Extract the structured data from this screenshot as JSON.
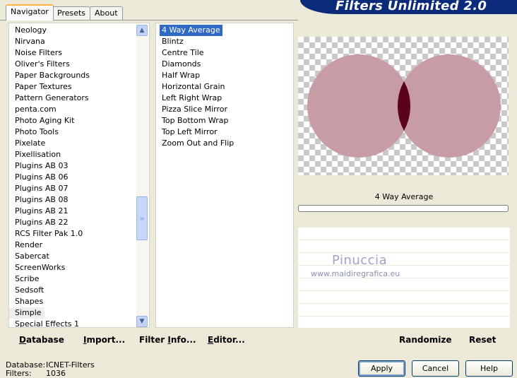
{
  "banner": {
    "title": "Filters Unlimited 2.0"
  },
  "tabs": [
    {
      "label": "Navigator"
    },
    {
      "label": "Presets"
    },
    {
      "label": "About"
    }
  ],
  "categories": {
    "items": [
      "Neology",
      "Nirvana",
      "Noise Filters",
      "Oliver's Filters",
      "Paper Backgrounds",
      "Paper Textures",
      "Pattern Generators",
      "penta.com",
      "Photo Aging Kit",
      "Photo Tools",
      "Pixelate",
      "Pixellisation",
      "Plugins AB 03",
      "Plugins AB 06",
      "Plugins AB 07",
      "Plugins AB 08",
      "Plugins AB 21",
      "Plugins AB 22",
      "RCS Filter Pak 1.0",
      "Render",
      "Sabercat",
      "ScreenWorks",
      "Scribe",
      "Sedsoft",
      "Shapes",
      "Simple",
      "Special Effects 1"
    ],
    "selected": "Simple",
    "scroll_position": 0.68
  },
  "filters": {
    "items": [
      "4 Way Average",
      "Blintz",
      "Centre Tile",
      "Diamonds",
      "Half Wrap",
      "Horizontal Grain",
      "Left Right Wrap",
      "Pizza Slice Mirror",
      "Top Bottom Wrap",
      "Top Left Mirror",
      "Zoom Out and Flip"
    ],
    "selected": "4 Way Average"
  },
  "preview": {
    "filter_name": "4 Way Average",
    "circle_color": "#c79ca5",
    "overlap_color": "#5a0319"
  },
  "watermark": {
    "name": "Pinuccia",
    "url": "www.maidiregrafica.eu"
  },
  "panel_buttons": {
    "database": {
      "u": "D",
      "rest": "atabase"
    },
    "import": {
      "u": "I",
      "rest": "mport..."
    },
    "filter_info": {
      "pre": "Filter ",
      "u": "I",
      "rest": "nfo..."
    },
    "editor": {
      "u": "E",
      "rest": "ditor..."
    },
    "randomize": "Randomize",
    "reset": "Reset"
  },
  "status": {
    "database_label": "Database:",
    "database_value": "ICNET-Filters",
    "filters_label": "Filters:",
    "filters_value": "1036"
  },
  "dialog_buttons": {
    "apply": "Apply",
    "cancel": "Cancel",
    "help": "Help"
  }
}
